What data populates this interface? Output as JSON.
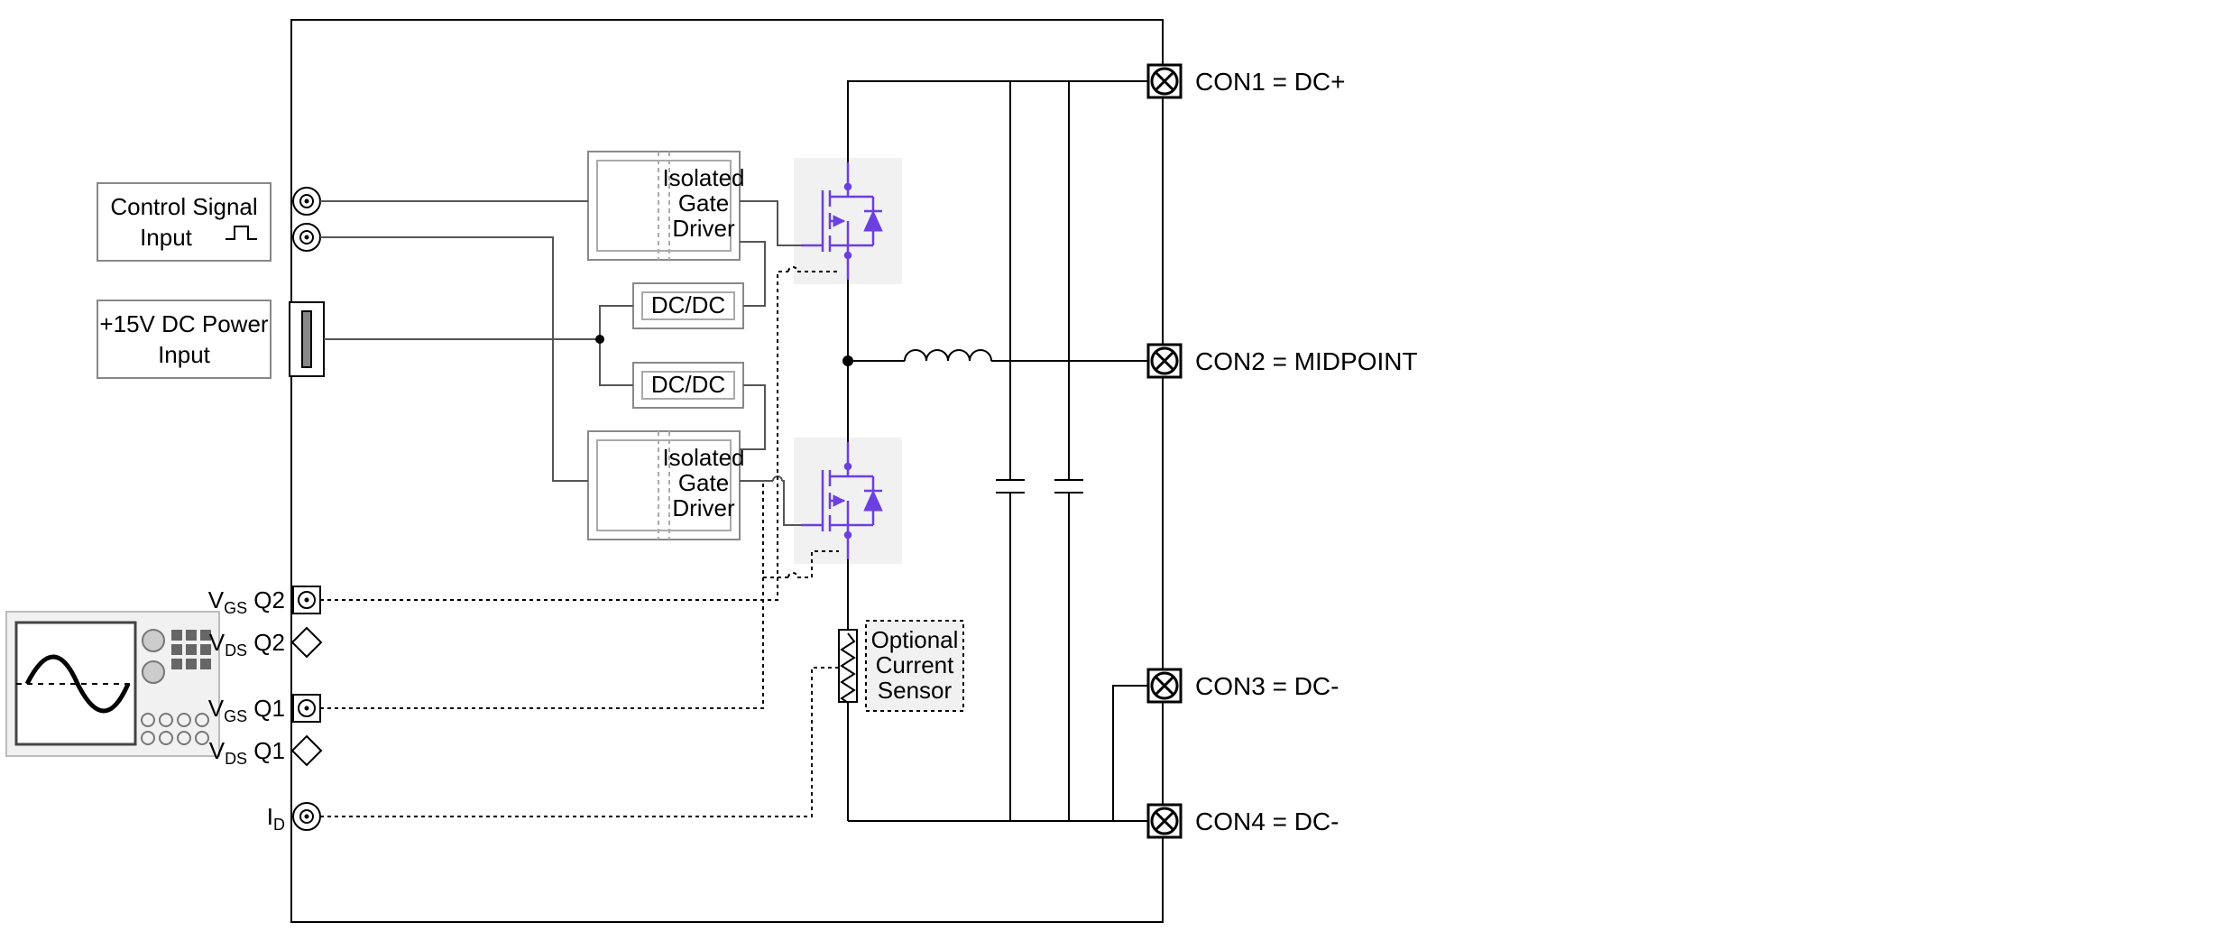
{
  "external_blocks": {
    "control_signal": {
      "line1": "Control Signal",
      "line2": "Input"
    },
    "power_input": {
      "line1": "+15V DC Power",
      "line2": "Input"
    }
  },
  "internal_blocks": {
    "gate_driver_top": {
      "line1": "Isolated",
      "line2": "Gate",
      "line3": "Driver"
    },
    "gate_driver_bottom": {
      "line1": "Isolated",
      "line2": "Gate",
      "line3": "Driver"
    },
    "dcdc_top": "DC/DC",
    "dcdc_bottom": "DC/DC",
    "current_sensor": {
      "line1": "Optional",
      "line2": "Current",
      "line3": "Sensor"
    }
  },
  "probes": {
    "vgs_q2": {
      "prefix": "V",
      "sub": "GS",
      "suffix": " Q2"
    },
    "vds_q2": {
      "prefix": "V",
      "sub": "DS",
      "suffix": " Q2"
    },
    "vgs_q1": {
      "prefix": "V",
      "sub": "GS",
      "suffix": " Q1"
    },
    "vds_q1": {
      "prefix": "V",
      "sub": "DS",
      "suffix": " Q1"
    },
    "id": {
      "prefix": "I",
      "sub": "D",
      "suffix": ""
    }
  },
  "connectors": {
    "con1": "CON1 = DC+",
    "con2": "CON2 = MIDPOINT",
    "con3": "CON3 = DC-",
    "con4": "CON4 = DC-"
  },
  "colors": {
    "mosfet": "#6b3fe0",
    "grey_fill": "#f1f1f1"
  }
}
